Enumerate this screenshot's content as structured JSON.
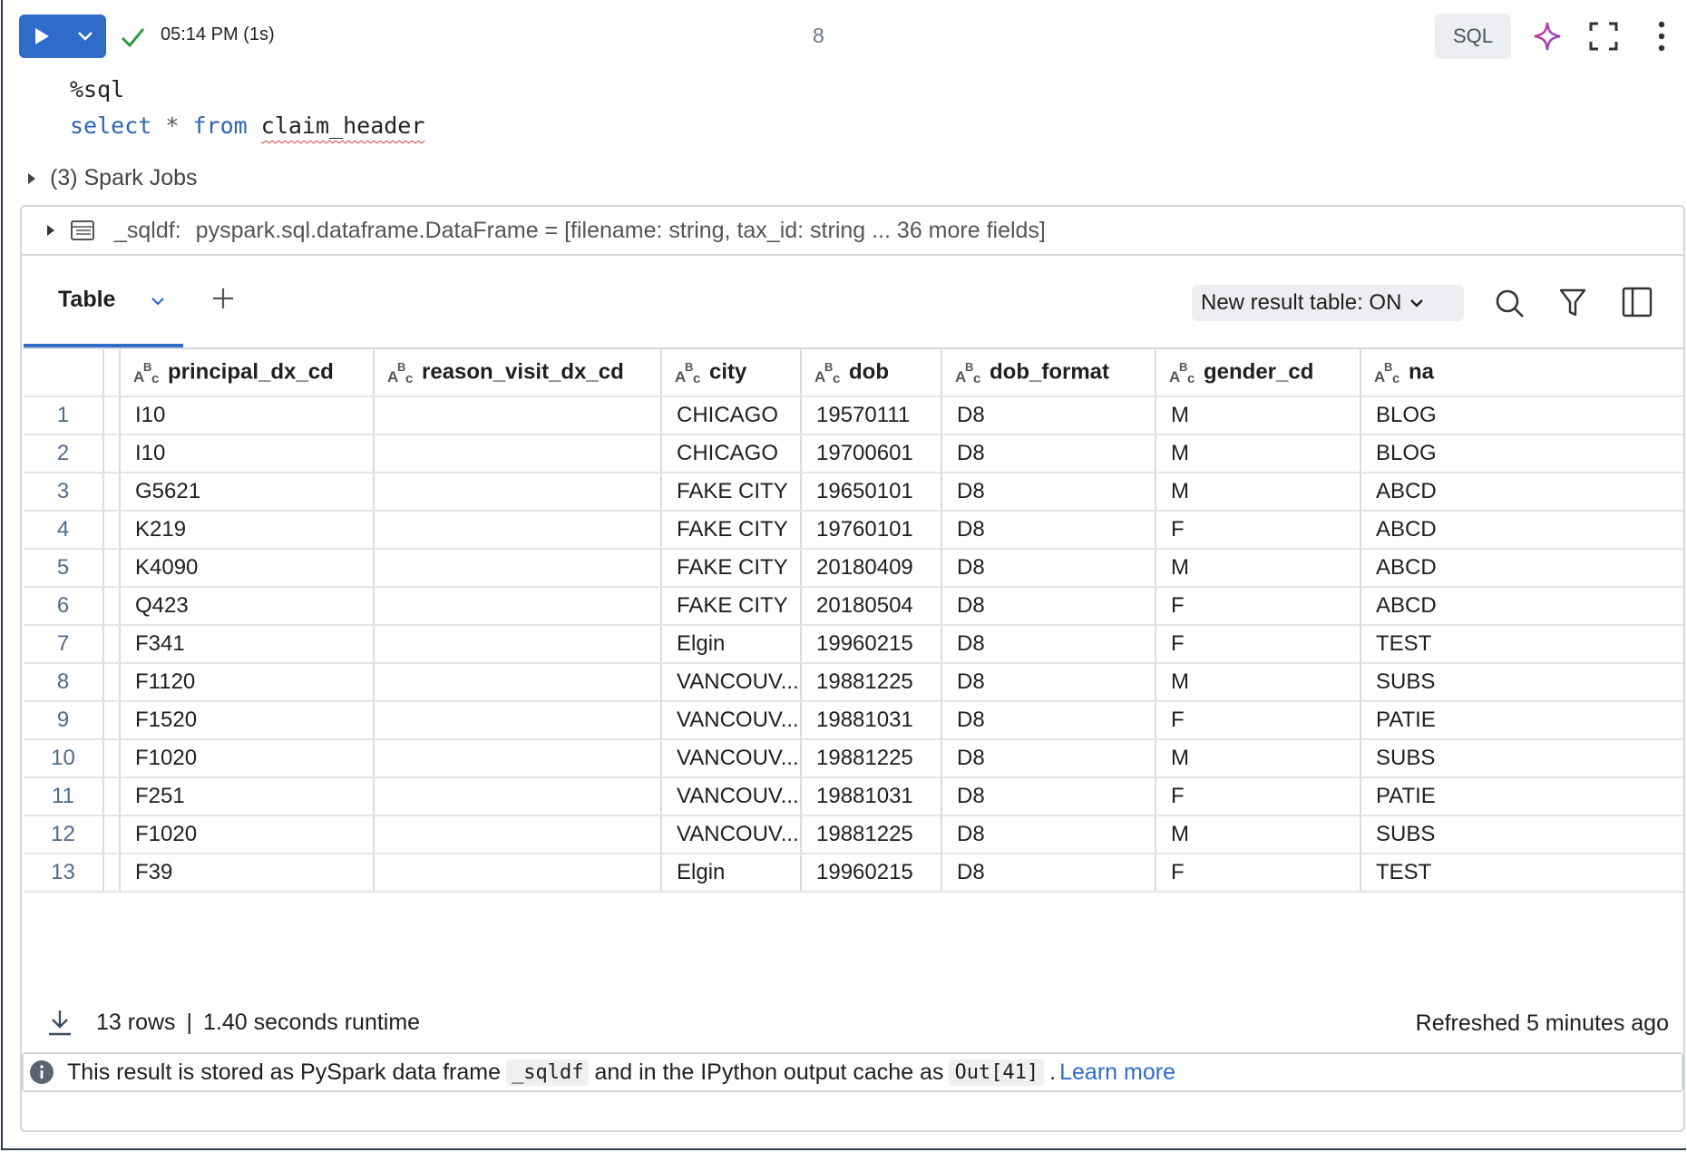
{
  "toolbar": {
    "run_status_time": "05:14 PM (1s)",
    "cell_number": "8",
    "language": "SQL"
  },
  "code": {
    "line1": "%sql",
    "kw_select": "select",
    "op_star": "*",
    "kw_from": "from",
    "table_name": "claim_header"
  },
  "spark_jobs": "(3) Spark Jobs",
  "dataframe": {
    "name": "_sqldf:",
    "schema": "pyspark.sql.dataframe.DataFrame = [filename: string, tax_id: string ... 36 more fields]"
  },
  "tabs": {
    "active": "Table"
  },
  "result_toggle": "New result table: ON",
  "table": {
    "columns": [
      "principal_dx_cd",
      "reason_visit_dx_cd",
      "city",
      "dob",
      "dob_format",
      "gender_cd",
      "na"
    ],
    "rows": [
      [
        "1",
        "I10",
        "",
        "CHICAGO",
        "19570111",
        "D8",
        "M",
        "BLOG"
      ],
      [
        "2",
        "I10",
        "",
        "CHICAGO",
        "19700601",
        "D8",
        "M",
        "BLOG"
      ],
      [
        "3",
        "G5621",
        "",
        "FAKE CITY",
        "19650101",
        "D8",
        "M",
        "ABCD"
      ],
      [
        "4",
        "K219",
        "",
        "FAKE CITY",
        "19760101",
        "D8",
        "F",
        "ABCD"
      ],
      [
        "5",
        "K4090",
        "",
        "FAKE CITY",
        "20180409",
        "D8",
        "M",
        "ABCD"
      ],
      [
        "6",
        "Q423",
        "",
        "FAKE CITY",
        "20180504",
        "D8",
        "F",
        "ABCD"
      ],
      [
        "7",
        "F341",
        "",
        "Elgin",
        "19960215",
        "D8",
        "F",
        "TEST"
      ],
      [
        "8",
        "F1120",
        "",
        "VANCOUV...",
        "19881225",
        "D8",
        "M",
        "SUBS"
      ],
      [
        "9",
        "F1520",
        "",
        "VANCOUV...",
        "19881031",
        "D8",
        "F",
        "PATIE"
      ],
      [
        "10",
        "F1020",
        "",
        "VANCOUV...",
        "19881225",
        "D8",
        "M",
        "SUBS"
      ],
      [
        "11",
        "F251",
        "",
        "VANCOUV...",
        "19881031",
        "D8",
        "F",
        "PATIE"
      ],
      [
        "12",
        "F1020",
        "",
        "VANCOUV...",
        "19881225",
        "D8",
        "M",
        "SUBS"
      ],
      [
        "13",
        "F39",
        "",
        "Elgin",
        "19960215",
        "D8",
        "F",
        "TEST"
      ]
    ]
  },
  "footer": {
    "rows_count": "13 rows",
    "separator": "|",
    "runtime": "1.40 seconds runtime",
    "refreshed": "Refreshed 5 minutes ago"
  },
  "info": {
    "text1": "This result is stored as PySpark data frame",
    "chip1": "_sqldf",
    "text2": "and in the IPython output cache as",
    "chip2": "Out[41]",
    "text3": ".",
    "link": "Learn more"
  },
  "colors": {
    "accent": "#2f6bc9",
    "success": "#2e9b45",
    "error_underline": "#d63a3a"
  },
  "icons": [
    "play-icon",
    "chevron-down-icon",
    "check-icon",
    "sparkle-icon",
    "expand-icon",
    "kebab-icon",
    "table-icon",
    "plus-icon",
    "search-icon",
    "filter-icon",
    "panel-icon",
    "download-icon",
    "info-icon",
    "string-type-icon"
  ]
}
